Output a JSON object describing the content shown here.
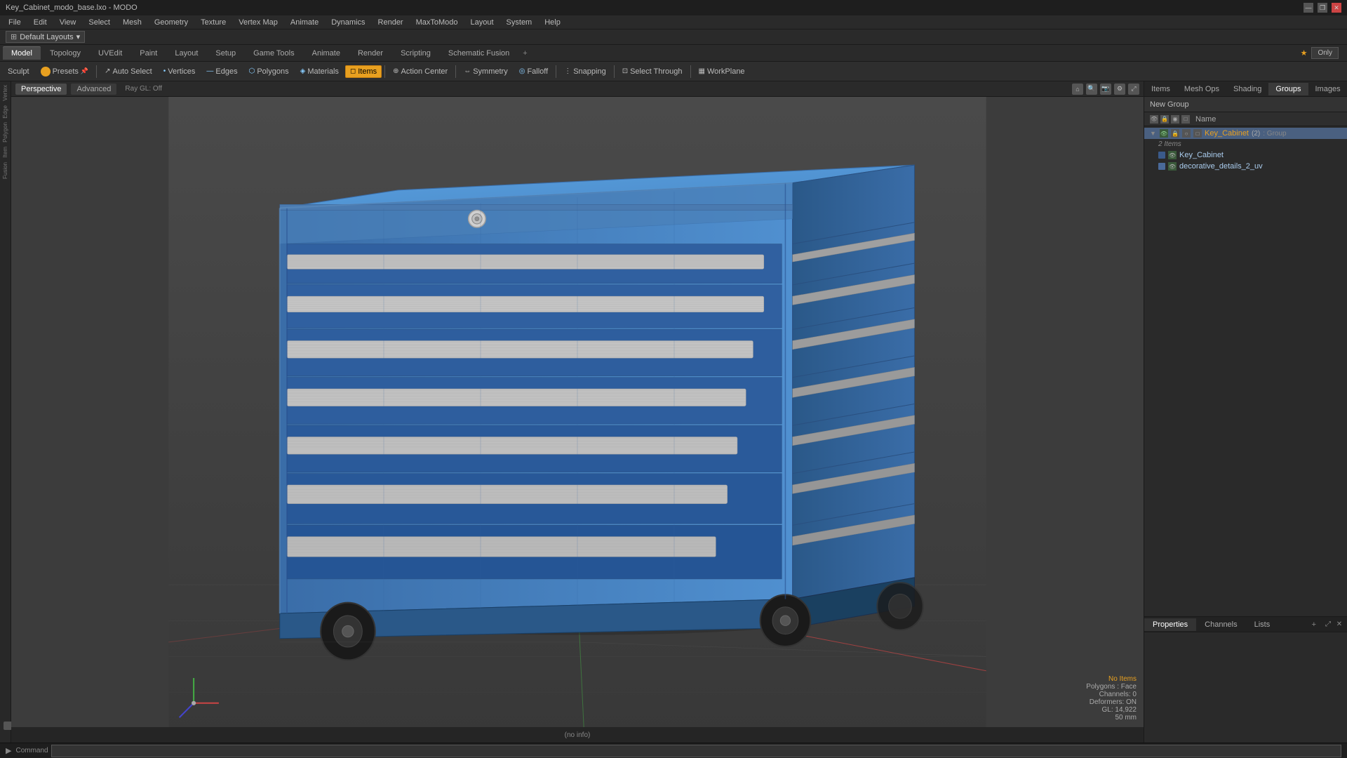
{
  "window": {
    "title": "Key_Cabinet_modo_base.lxo - MODO"
  },
  "titleBar": {
    "title": "Key_Cabinet_modo_base.lxo - MODO",
    "minimize": "—",
    "restore": "❐",
    "close": "✕"
  },
  "menuBar": {
    "items": [
      "File",
      "Edit",
      "View",
      "Select",
      "Mesh",
      "Geometry",
      "Texture",
      "Vertex Map",
      "Animate",
      "Dynamics",
      "Render",
      "MaxToModo",
      "Layout",
      "System",
      "Help"
    ]
  },
  "layoutBar": {
    "selector": "Default Layouts",
    "dropdown": "▾"
  },
  "modeTabs": {
    "tabs": [
      "Model",
      "Topology",
      "UVEdit",
      "Paint",
      "Layout",
      "Setup",
      "Game Tools",
      "Animate",
      "Render",
      "Scripting",
      "Schematic Fusion"
    ],
    "active": "Model",
    "plus": "+",
    "right": {
      "only": "Only",
      "star": "★"
    }
  },
  "toolbar": {
    "sculpt": "Sculpt",
    "presets": "Presets",
    "autoSelect": "Auto Select",
    "vertices": "Vertices",
    "edges": "Edges",
    "polygons": "Polygons",
    "materials": "Materials",
    "items": "Items",
    "actionCenter": "Action Center",
    "symmetry": "Symmetry",
    "falloff": "Falloff",
    "snapping": "Snapping",
    "selectThrough": "Select Through",
    "workPlane": "WorkPlane"
  },
  "viewport": {
    "tabs": [
      "Perspective",
      "Advanced"
    ],
    "rayGL": "Ray GL: Off",
    "icons": [
      "🔄",
      "🔍",
      "⚙",
      "📷"
    ]
  },
  "scene": {
    "bottomInfo": {
      "noItems": "No Items",
      "polygons": "Polygons : Face",
      "channels": "Channels: 0",
      "deformers": "Deformers: ON",
      "gl": "GL: 14,922",
      "units": "50 mm"
    },
    "statusBar": "(no info)"
  },
  "rightPanel": {
    "tabs": [
      "Items",
      "Mesh Ops",
      "Shading",
      "Groups",
      "Images"
    ],
    "active": "Groups",
    "plus": "+",
    "newGroup": "New Group",
    "header": {
      "name": "Name"
    },
    "tree": {
      "items": [
        {
          "label": "Key_Cabinet",
          "count": "(2)",
          "suffix": ": Group",
          "expanded": true,
          "selected": true,
          "level": 0,
          "color": "#4a7fbf"
        },
        {
          "label": "2 Items",
          "level": 1,
          "italic": true,
          "color": "#888"
        },
        {
          "label": "Key_Cabinet",
          "level": 2,
          "color": "#8fc0e8"
        },
        {
          "label": "decorative_details_2_uv",
          "level": 2,
          "color": "#8fc0e8"
        }
      ]
    }
  },
  "bottomPanel": {
    "tabs": [
      "Properties",
      "Channels",
      "Lists"
    ],
    "active": "Properties",
    "plus": "+"
  },
  "statusBar": {
    "commandLabel": "Command",
    "commandPlaceholder": ""
  },
  "leftSidebar": {
    "items": [
      "Vertex",
      "Edge",
      "Polygon",
      "Item",
      "Fusion"
    ]
  },
  "leftTools": {
    "items": [
      "Vertex",
      "Edge",
      "Polygon",
      "Item",
      "Fusion"
    ]
  }
}
